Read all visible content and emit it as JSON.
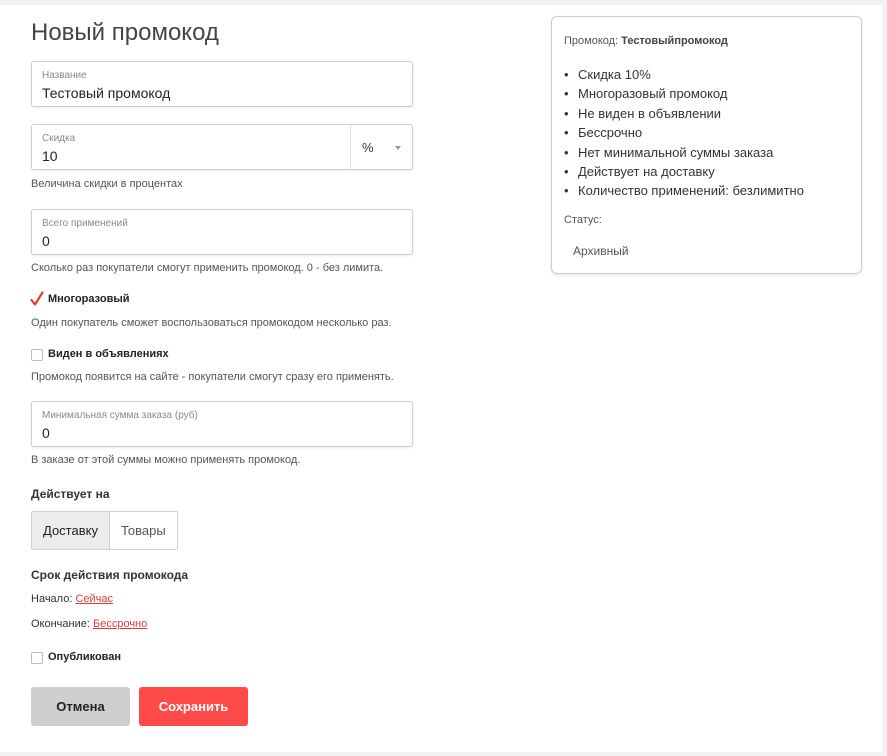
{
  "page": {
    "title": "Новый промокод"
  },
  "form": {
    "name": {
      "label": "Название",
      "value": "Тестовый промокод"
    },
    "discount": {
      "label": "Скидка",
      "value": "10",
      "unit": "%",
      "hint": "Величина скидки в процентах"
    },
    "total_uses": {
      "label": "Всего применений",
      "value": "0",
      "hint": "Сколько раз покупатели смогут применить промокод. 0 - без лимита."
    },
    "reusable": {
      "label": "Многоразовый",
      "checked": true,
      "hint": "Один покупатель сможет воспользоваться промокодом несколько раз."
    },
    "visible": {
      "label": "Виден в объявлениях",
      "checked": false,
      "hint": "Промокод появится на сайте - покупатели смогут сразу его применять."
    },
    "min_sum": {
      "label": "Минимальная сумма заказа (руб)",
      "value": "0",
      "hint": "В заказе от этой суммы можно применять промокод."
    },
    "applies_to": {
      "label": "Действует на",
      "options": [
        "Доставку",
        "Товары"
      ],
      "selected": "Доставку"
    },
    "validity": {
      "label": "Срок действия промокода",
      "start_label": "Начало:",
      "start_value": "Сейчас",
      "end_label": "Окончание:",
      "end_value": "Бессрочно"
    },
    "published": {
      "label": "Опубликован",
      "checked": false
    }
  },
  "actions": {
    "cancel": "Отмена",
    "save": "Сохранить"
  },
  "summary": {
    "title_label": "Промокод:",
    "title_value": "Тестовыйпромокод",
    "items": [
      "Скидка 10%",
      "Многоразовый промокод",
      "Не виден в объявлении",
      "Бессрочно",
      "Нет минимальной суммы заказа",
      "Действует на доставку",
      "Количество применений: безлимитно"
    ],
    "status_label": "Статус:",
    "status_value": "Архивный"
  },
  "colors": {
    "accent": "#ff4a4a",
    "link": "#e03b3b",
    "check": "#e53935"
  }
}
